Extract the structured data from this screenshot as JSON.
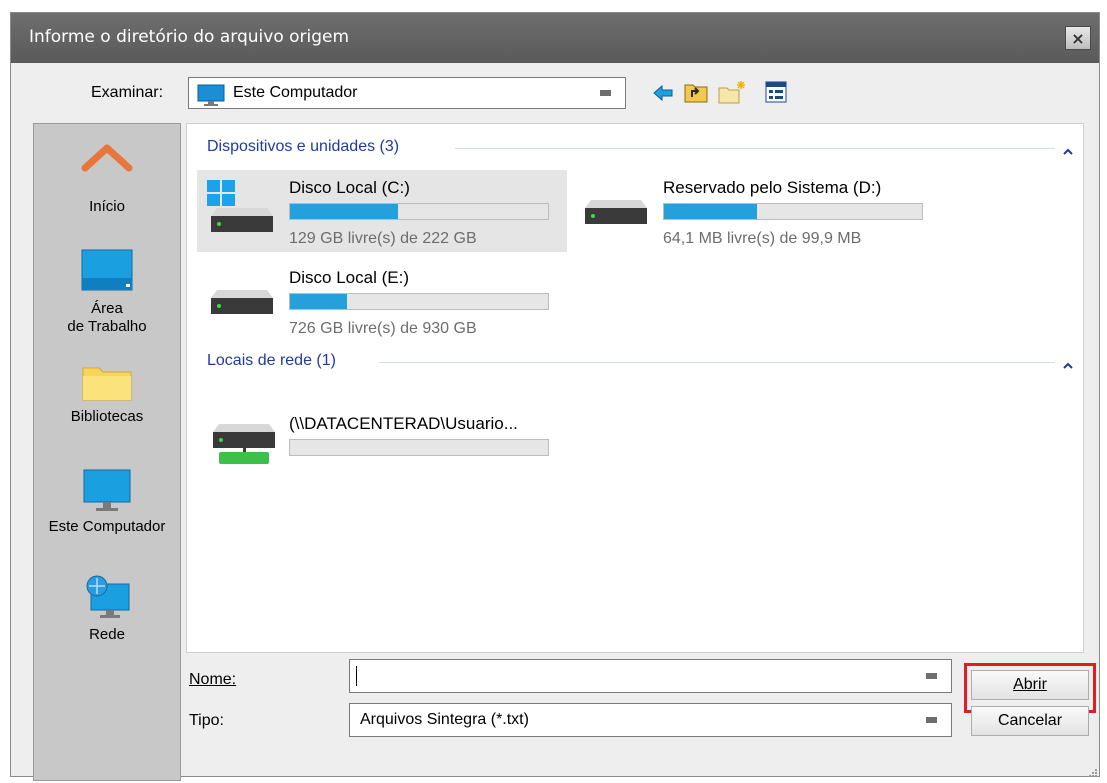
{
  "window": {
    "title": "Informe o diretório do arquivo origem",
    "close_symbol": "×"
  },
  "toolbar": {
    "look_in_label": "Examinar:",
    "look_in_value": "Este Computador",
    "icons": [
      "back-arrow-icon",
      "up-folder-icon",
      "new-folder-icon",
      "view-menu-icon"
    ]
  },
  "places": [
    {
      "label": "Início",
      "icon": "home-icon"
    },
    {
      "label": "Área\nde Trabalho",
      "icon": "desktop-icon"
    },
    {
      "label": "Bibliotecas",
      "icon": "libraries-folder-icon"
    },
    {
      "label": "Este Computador",
      "icon": "computer-icon"
    },
    {
      "label": "Rede",
      "icon": "network-icon"
    }
  ],
  "groups": {
    "devices": {
      "title": "Dispositivos e unidades (3)",
      "drives": [
        {
          "name": "Disco Local (C:)",
          "info": "129 GB livre(s) de 222 GB",
          "used": 0.42,
          "selected": true,
          "icon": "windows-drive-icon"
        },
        {
          "name": "Reservado pelo Sistema (D:)",
          "info": "64,1 MB livre(s) de 99,9 MB",
          "used": 0.36,
          "selected": false,
          "icon": "hard-drive-icon"
        },
        {
          "name": "Disco Local (E:)",
          "info": "726 GB livre(s) de 930 GB",
          "used": 0.22,
          "selected": false,
          "icon": "hard-drive-icon"
        }
      ]
    },
    "network": {
      "title": "Locais de rede (1)",
      "drives": [
        {
          "name": "(\\\\DATACENTERAD\\Usuario...",
          "info": "",
          "used": 0,
          "selected": false,
          "icon": "network-drive-icon"
        }
      ]
    }
  },
  "footer": {
    "name_label": "Nome:",
    "name_value": "",
    "type_label": "Tipo:",
    "type_value": "Arquivos Sintegra (*.txt)",
    "open_button": "Abrir",
    "cancel_button": "Cancelar"
  },
  "colors": {
    "highlight_outline": "#e11c24",
    "bar_fill": "#26a0da",
    "group_title": "#1e3ca0"
  }
}
